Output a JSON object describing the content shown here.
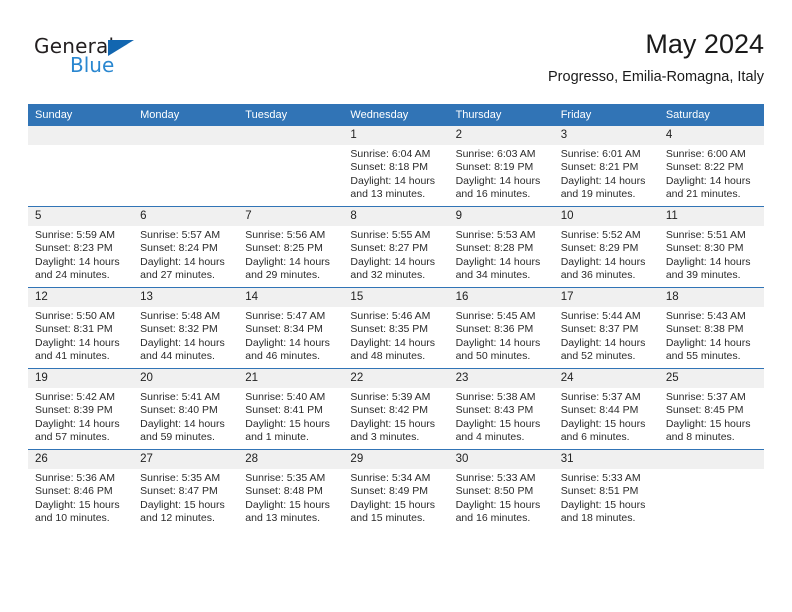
{
  "brand": {
    "name_part1": "General",
    "name_part2": "Blue",
    "triangle_color": "#1266b0",
    "blue_color": "#2a87d0"
  },
  "header": {
    "title": "May 2024",
    "subtitle": "Progresso, Emilia-Romagna, Italy"
  },
  "theme": {
    "header_bar": "#3174b6",
    "daynum_band": "#f0f0f0",
    "week_rule": "#3174b6"
  },
  "weekday_headers": [
    "Sunday",
    "Monday",
    "Tuesday",
    "Wednesday",
    "Thursday",
    "Friday",
    "Saturday"
  ],
  "weeks": [
    [
      {
        "day": "",
        "empty": true
      },
      {
        "day": "",
        "empty": true
      },
      {
        "day": "",
        "empty": true
      },
      {
        "day": "1",
        "sunrise": "Sunrise: 6:04 AM",
        "sunset": "Sunset: 8:18 PM",
        "daylight": "Daylight: 14 hours and 13 minutes."
      },
      {
        "day": "2",
        "sunrise": "Sunrise: 6:03 AM",
        "sunset": "Sunset: 8:19 PM",
        "daylight": "Daylight: 14 hours and 16 minutes."
      },
      {
        "day": "3",
        "sunrise": "Sunrise: 6:01 AM",
        "sunset": "Sunset: 8:21 PM",
        "daylight": "Daylight: 14 hours and 19 minutes."
      },
      {
        "day": "4",
        "sunrise": "Sunrise: 6:00 AM",
        "sunset": "Sunset: 8:22 PM",
        "daylight": "Daylight: 14 hours and 21 minutes."
      }
    ],
    [
      {
        "day": "5",
        "sunrise": "Sunrise: 5:59 AM",
        "sunset": "Sunset: 8:23 PM",
        "daylight": "Daylight: 14 hours and 24 minutes."
      },
      {
        "day": "6",
        "sunrise": "Sunrise: 5:57 AM",
        "sunset": "Sunset: 8:24 PM",
        "daylight": "Daylight: 14 hours and 27 minutes."
      },
      {
        "day": "7",
        "sunrise": "Sunrise: 5:56 AM",
        "sunset": "Sunset: 8:25 PM",
        "daylight": "Daylight: 14 hours and 29 minutes."
      },
      {
        "day": "8",
        "sunrise": "Sunrise: 5:55 AM",
        "sunset": "Sunset: 8:27 PM",
        "daylight": "Daylight: 14 hours and 32 minutes."
      },
      {
        "day": "9",
        "sunrise": "Sunrise: 5:53 AM",
        "sunset": "Sunset: 8:28 PM",
        "daylight": "Daylight: 14 hours and 34 minutes."
      },
      {
        "day": "10",
        "sunrise": "Sunrise: 5:52 AM",
        "sunset": "Sunset: 8:29 PM",
        "daylight": "Daylight: 14 hours and 36 minutes."
      },
      {
        "day": "11",
        "sunrise": "Sunrise: 5:51 AM",
        "sunset": "Sunset: 8:30 PM",
        "daylight": "Daylight: 14 hours and 39 minutes."
      }
    ],
    [
      {
        "day": "12",
        "sunrise": "Sunrise: 5:50 AM",
        "sunset": "Sunset: 8:31 PM",
        "daylight": "Daylight: 14 hours and 41 minutes."
      },
      {
        "day": "13",
        "sunrise": "Sunrise: 5:48 AM",
        "sunset": "Sunset: 8:32 PM",
        "daylight": "Daylight: 14 hours and 44 minutes."
      },
      {
        "day": "14",
        "sunrise": "Sunrise: 5:47 AM",
        "sunset": "Sunset: 8:34 PM",
        "daylight": "Daylight: 14 hours and 46 minutes."
      },
      {
        "day": "15",
        "sunrise": "Sunrise: 5:46 AM",
        "sunset": "Sunset: 8:35 PM",
        "daylight": "Daylight: 14 hours and 48 minutes."
      },
      {
        "day": "16",
        "sunrise": "Sunrise: 5:45 AM",
        "sunset": "Sunset: 8:36 PM",
        "daylight": "Daylight: 14 hours and 50 minutes."
      },
      {
        "day": "17",
        "sunrise": "Sunrise: 5:44 AM",
        "sunset": "Sunset: 8:37 PM",
        "daylight": "Daylight: 14 hours and 52 minutes."
      },
      {
        "day": "18",
        "sunrise": "Sunrise: 5:43 AM",
        "sunset": "Sunset: 8:38 PM",
        "daylight": "Daylight: 14 hours and 55 minutes."
      }
    ],
    [
      {
        "day": "19",
        "sunrise": "Sunrise: 5:42 AM",
        "sunset": "Sunset: 8:39 PM",
        "daylight": "Daylight: 14 hours and 57 minutes."
      },
      {
        "day": "20",
        "sunrise": "Sunrise: 5:41 AM",
        "sunset": "Sunset: 8:40 PM",
        "daylight": "Daylight: 14 hours and 59 minutes."
      },
      {
        "day": "21",
        "sunrise": "Sunrise: 5:40 AM",
        "sunset": "Sunset: 8:41 PM",
        "daylight": "Daylight: 15 hours and 1 minute."
      },
      {
        "day": "22",
        "sunrise": "Sunrise: 5:39 AM",
        "sunset": "Sunset: 8:42 PM",
        "daylight": "Daylight: 15 hours and 3 minutes."
      },
      {
        "day": "23",
        "sunrise": "Sunrise: 5:38 AM",
        "sunset": "Sunset: 8:43 PM",
        "daylight": "Daylight: 15 hours and 4 minutes."
      },
      {
        "day": "24",
        "sunrise": "Sunrise: 5:37 AM",
        "sunset": "Sunset: 8:44 PM",
        "daylight": "Daylight: 15 hours and 6 minutes."
      },
      {
        "day": "25",
        "sunrise": "Sunrise: 5:37 AM",
        "sunset": "Sunset: 8:45 PM",
        "daylight": "Daylight: 15 hours and 8 minutes."
      }
    ],
    [
      {
        "day": "26",
        "sunrise": "Sunrise: 5:36 AM",
        "sunset": "Sunset: 8:46 PM",
        "daylight": "Daylight: 15 hours and 10 minutes."
      },
      {
        "day": "27",
        "sunrise": "Sunrise: 5:35 AM",
        "sunset": "Sunset: 8:47 PM",
        "daylight": "Daylight: 15 hours and 12 minutes."
      },
      {
        "day": "28",
        "sunrise": "Sunrise: 5:35 AM",
        "sunset": "Sunset: 8:48 PM",
        "daylight": "Daylight: 15 hours and 13 minutes."
      },
      {
        "day": "29",
        "sunrise": "Sunrise: 5:34 AM",
        "sunset": "Sunset: 8:49 PM",
        "daylight": "Daylight: 15 hours and 15 minutes."
      },
      {
        "day": "30",
        "sunrise": "Sunrise: 5:33 AM",
        "sunset": "Sunset: 8:50 PM",
        "daylight": "Daylight: 15 hours and 16 minutes."
      },
      {
        "day": "31",
        "sunrise": "Sunrise: 5:33 AM",
        "sunset": "Sunset: 8:51 PM",
        "daylight": "Daylight: 15 hours and 18 minutes."
      },
      {
        "day": "",
        "empty": true
      }
    ]
  ]
}
